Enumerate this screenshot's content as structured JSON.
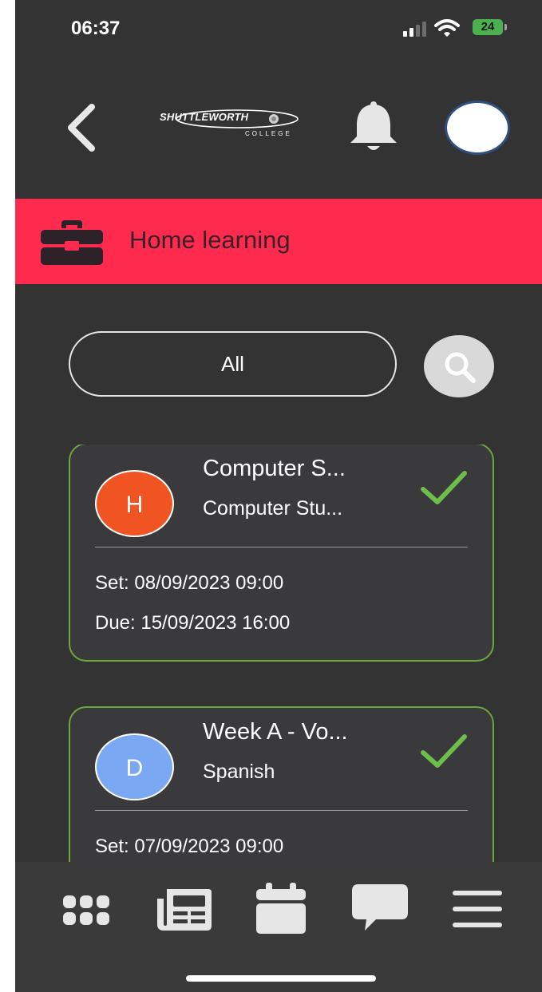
{
  "status_bar": {
    "time": "06:37",
    "battery": "24"
  },
  "header": {
    "logo_text": "SHUTTLEWORTH",
    "logo_subtext": "COLLEGE",
    "icons": [
      "back-chevron-icon",
      "bell-icon",
      "avatar"
    ]
  },
  "banner": {
    "title": "Home learning",
    "icon": "briefcase-icon",
    "color": "#ff2b4f"
  },
  "filter": {
    "selected": "All",
    "search_icon": "magnifier-icon"
  },
  "items": [
    {
      "initial": "H",
      "badge_color": "#f05423",
      "title": "Computer S...",
      "subject": "Computer Stu...",
      "set": "Set: 08/09/2023 09:00",
      "due": "Due: 15/09/2023 16:00",
      "status_icon": "check-icon"
    },
    {
      "initial": "D",
      "badge_color": "#7aa8f2",
      "title": "Week A  - Vo...",
      "subject": "Spanish",
      "set": "Set: 07/09/2023 09:00",
      "due": "",
      "status_icon": "check-icon"
    }
  ],
  "bottom_nav": [
    "apps-grid-icon",
    "newspaper-icon",
    "calendar-icon",
    "chat-bubble-icon",
    "menu-icon"
  ],
  "colors": {
    "background": "#333333",
    "accent": "#ff2b4f",
    "card_border": "#6aa83a",
    "check": "#6cc04a"
  }
}
